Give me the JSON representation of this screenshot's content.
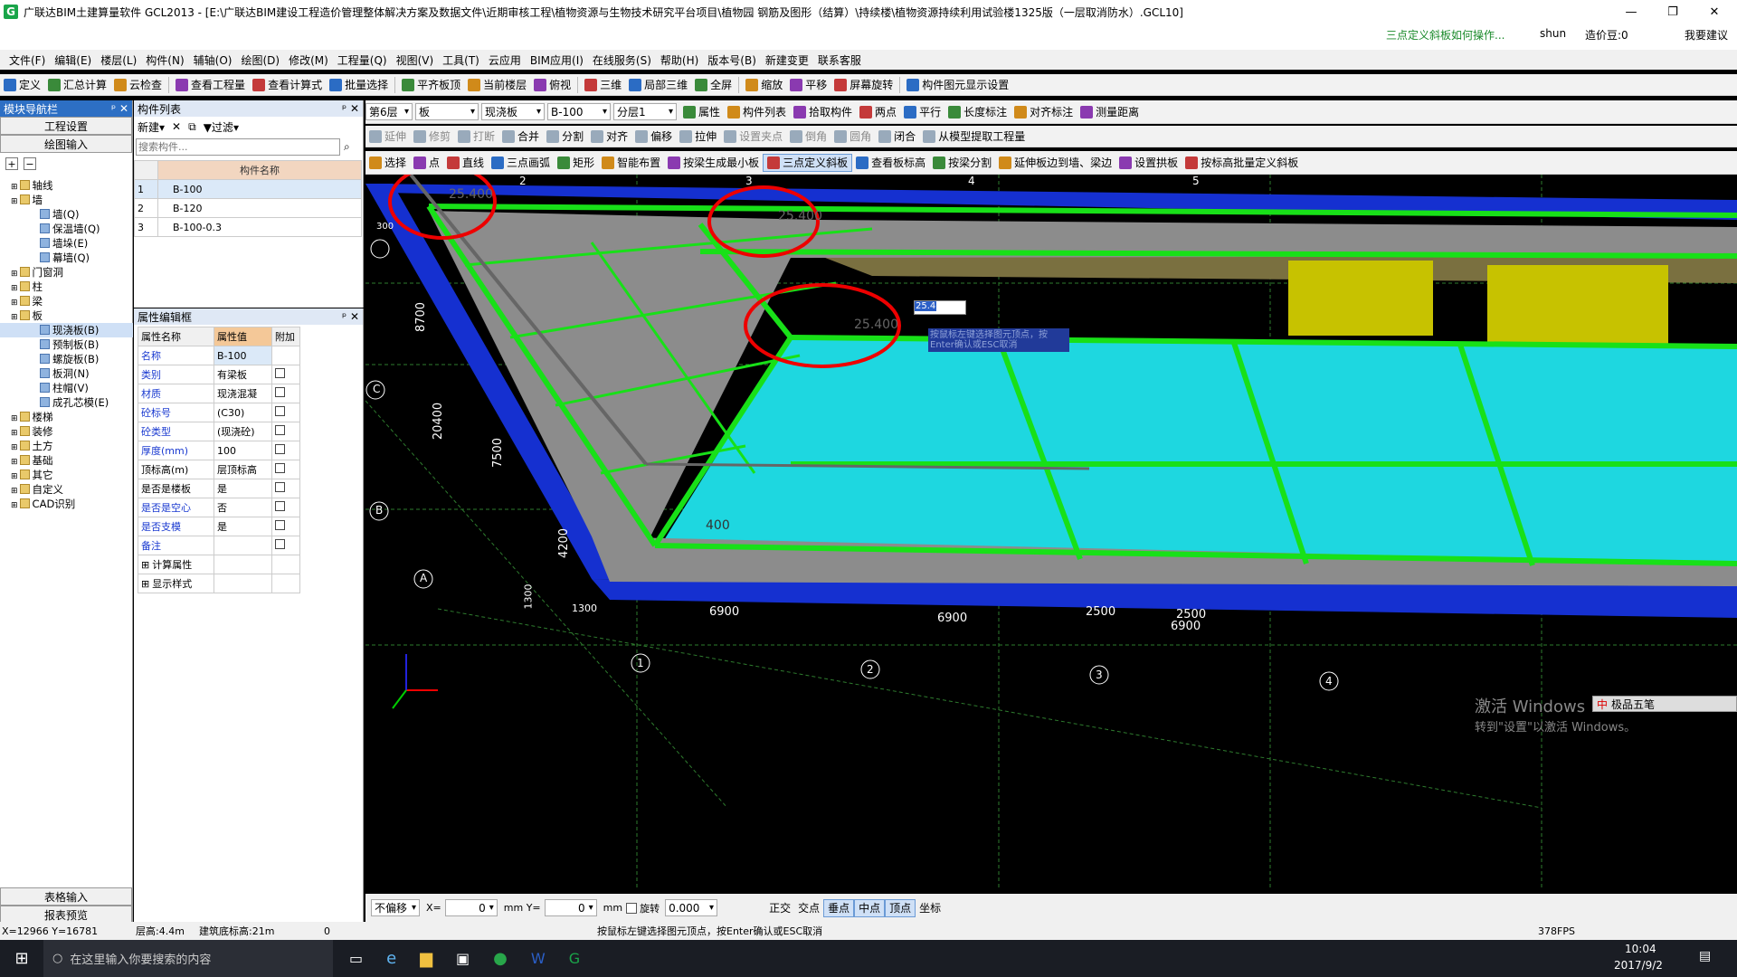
{
  "window": {
    "title": "广联达BIM土建算量软件 GCL2013 - [E:\\广联达BIM建设工程造价管理整体解决方案及数据文件\\近期审核工程\\植物资源与生物技术研究平台项目\\植物园 钢筋及图形（结算）\\持续楼\\植物资源持续利用试验楼1325版（一层取消防水）.GCL10]",
    "help_link": "三点定义斜板如何操作...",
    "user": "shun",
    "price_bean": "造价豆:0",
    "reply": "我要建议",
    "logo": "G"
  },
  "menu": [
    "文件(F)",
    "编辑(E)",
    "楼层(L)",
    "构件(N)",
    "辅轴(O)",
    "绘图(D)",
    "修改(M)",
    "工程量(Q)",
    "视图(V)",
    "工具(T)",
    "云应用",
    "BIM应用(I)",
    "在线服务(S)",
    "帮助(H)",
    "版本号(B)",
    "新建变更",
    "联系客服"
  ],
  "toolbar1": [
    "定义",
    "汇总计算",
    "云检查",
    "查看工程量",
    "查看计算式",
    "批量选择",
    "平齐板顶",
    "当前楼层",
    "俯视",
    "三维",
    "局部三维",
    "全屏",
    "缩放",
    "平移",
    "屏幕旋转",
    "构件图元显示设置"
  ],
  "toolbar2": {
    "floor": "第6层",
    "type": "板",
    "subtype": "现浇板",
    "component": "B-100",
    "layer": "分层1",
    "buttons": [
      "属性",
      "构件列表",
      "拾取构件",
      "两点",
      "平行",
      "长度标注",
      "对齐标注",
      "测量距离"
    ]
  },
  "toolbar3": [
    "延伸",
    "修剪",
    "打断",
    "合并",
    "分割",
    "对齐",
    "偏移",
    "拉伸",
    "设置夹点",
    "倒角",
    "圆角",
    "闭合",
    "从模型提取工程量"
  ],
  "toolbar4": [
    "选择",
    "点",
    "直线",
    "三点画弧",
    "矩形",
    "智能布置",
    "按梁生成最小板",
    "三点定义斜板",
    "查看板标高",
    "按梁分割",
    "延伸板边到墙、梁边",
    "设置拱板",
    "按标高批量定义斜板"
  ],
  "nav": {
    "title": "模块导航栏",
    "project_settings": "工程设置",
    "drawing_input": "绘图输入",
    "table_input": "表格输入",
    "report_preview": "报表预览",
    "tree": [
      {
        "label": "轴线",
        "lvl": 1
      },
      {
        "label": "墙",
        "lvl": 1
      },
      {
        "label": "墙(Q)",
        "lvl": 2
      },
      {
        "label": "保温墙(Q)",
        "lvl": 2
      },
      {
        "label": "墙垛(E)",
        "lvl": 2
      },
      {
        "label": "幕墙(Q)",
        "lvl": 2
      },
      {
        "label": "门窗洞",
        "lvl": 1
      },
      {
        "label": "柱",
        "lvl": 1
      },
      {
        "label": "梁",
        "lvl": 1
      },
      {
        "label": "板",
        "lvl": 1
      },
      {
        "label": "现浇板(B)",
        "lvl": 2,
        "sel": true
      },
      {
        "label": "预制板(B)",
        "lvl": 2
      },
      {
        "label": "螺旋板(B)",
        "lvl": 2
      },
      {
        "label": "板洞(N)",
        "lvl": 2
      },
      {
        "label": "柱帽(V)",
        "lvl": 2
      },
      {
        "label": "成孔芯模(E)",
        "lvl": 2
      },
      {
        "label": "楼梯",
        "lvl": 1
      },
      {
        "label": "装修",
        "lvl": 1
      },
      {
        "label": "土方",
        "lvl": 1
      },
      {
        "label": "基础",
        "lvl": 1
      },
      {
        "label": "其它",
        "lvl": 1
      },
      {
        "label": "自定义",
        "lvl": 1
      },
      {
        "label": "CAD识别",
        "lvl": 1
      }
    ]
  },
  "components": {
    "title": "构件列表",
    "new": "新建",
    "filter": "过滤",
    "search_placeholder": "搜索构件...",
    "col": "构件名称",
    "rows": [
      {
        "no": "1",
        "name": "B-100"
      },
      {
        "no": "2",
        "name": "B-120"
      },
      {
        "no": "3",
        "name": "B-100-0.3"
      }
    ]
  },
  "props": {
    "title": "属性编辑框",
    "cols": [
      "属性名称",
      "属性值",
      "附加"
    ],
    "rows": [
      {
        "k": "名称",
        "v": "B-100",
        "blue": true,
        "chk": false
      },
      {
        "k": "类别",
        "v": "有梁板",
        "blue": true,
        "chk": true
      },
      {
        "k": "材质",
        "v": "现浇混凝",
        "blue": true,
        "chk": true
      },
      {
        "k": "砼标号",
        "v": "(C30)",
        "blue": true,
        "chk": true
      },
      {
        "k": "砼类型",
        "v": "(现浇砼)",
        "blue": true,
        "chk": true
      },
      {
        "k": "厚度(mm)",
        "v": "100",
        "blue": true,
        "chk": true
      },
      {
        "k": "顶标高(m)",
        "v": "层顶标高",
        "blue": false,
        "chk": true
      },
      {
        "k": "是否是楼板",
        "v": "是",
        "blue": false,
        "chk": true
      },
      {
        "k": "是否是空心",
        "v": "否",
        "blue": true,
        "chk": true
      },
      {
        "k": "是否支模",
        "v": "是",
        "blue": true,
        "chk": true
      },
      {
        "k": "备注",
        "v": "",
        "blue": true,
        "chk": true
      },
      {
        "k": "计算属性",
        "v": "",
        "blue": false,
        "chk": false,
        "plus": true
      },
      {
        "k": "显示样式",
        "v": "",
        "blue": false,
        "chk": false,
        "plus": true
      }
    ]
  },
  "viewport": {
    "input_value": "25.4",
    "tooltip": "按鼠标左键选择图元顶点，按Enter确认或ESC取消",
    "labels": {
      "top_axes": [
        "2",
        "3",
        "4",
        "5"
      ],
      "bottom_axes": [
        "1",
        "2",
        "3",
        "4"
      ],
      "left_axes": [
        "C",
        "B",
        "A"
      ],
      "dims": [
        "8700",
        "20400",
        "7500",
        "4200",
        "6900",
        "6900",
        "2500",
        "2500",
        "6900",
        "1300",
        "1300",
        "300"
      ],
      "circle_texts": [
        "25.400",
        "25.400",
        "25.400"
      ],
      "pt_label": "400"
    },
    "watermark1": "激活 Windows",
    "watermark2": "转到\"设置\"以激活 Windows。",
    "ime": "极品五笔"
  },
  "bottombar": {
    "no_offset": "不偏移",
    "x": "0",
    "y": "0",
    "rotate": "旋转",
    "angle": "0.000",
    "snaps": [
      "正交",
      "交点",
      "垂点",
      "中点",
      "顶点",
      "坐标"
    ]
  },
  "status": {
    "coords": "X=12966 Y=16781",
    "floor_height": "层高:4.4m",
    "base_height": "建筑底标高:21m",
    "zero": "0",
    "hint": "按鼠标左键选择图元顶点，按Enter确认或ESC取消",
    "fps": "378FPS"
  },
  "taskbar": {
    "search": "在这里输入你要搜索的内容",
    "time": "10:04",
    "date": "2017/9/2"
  }
}
